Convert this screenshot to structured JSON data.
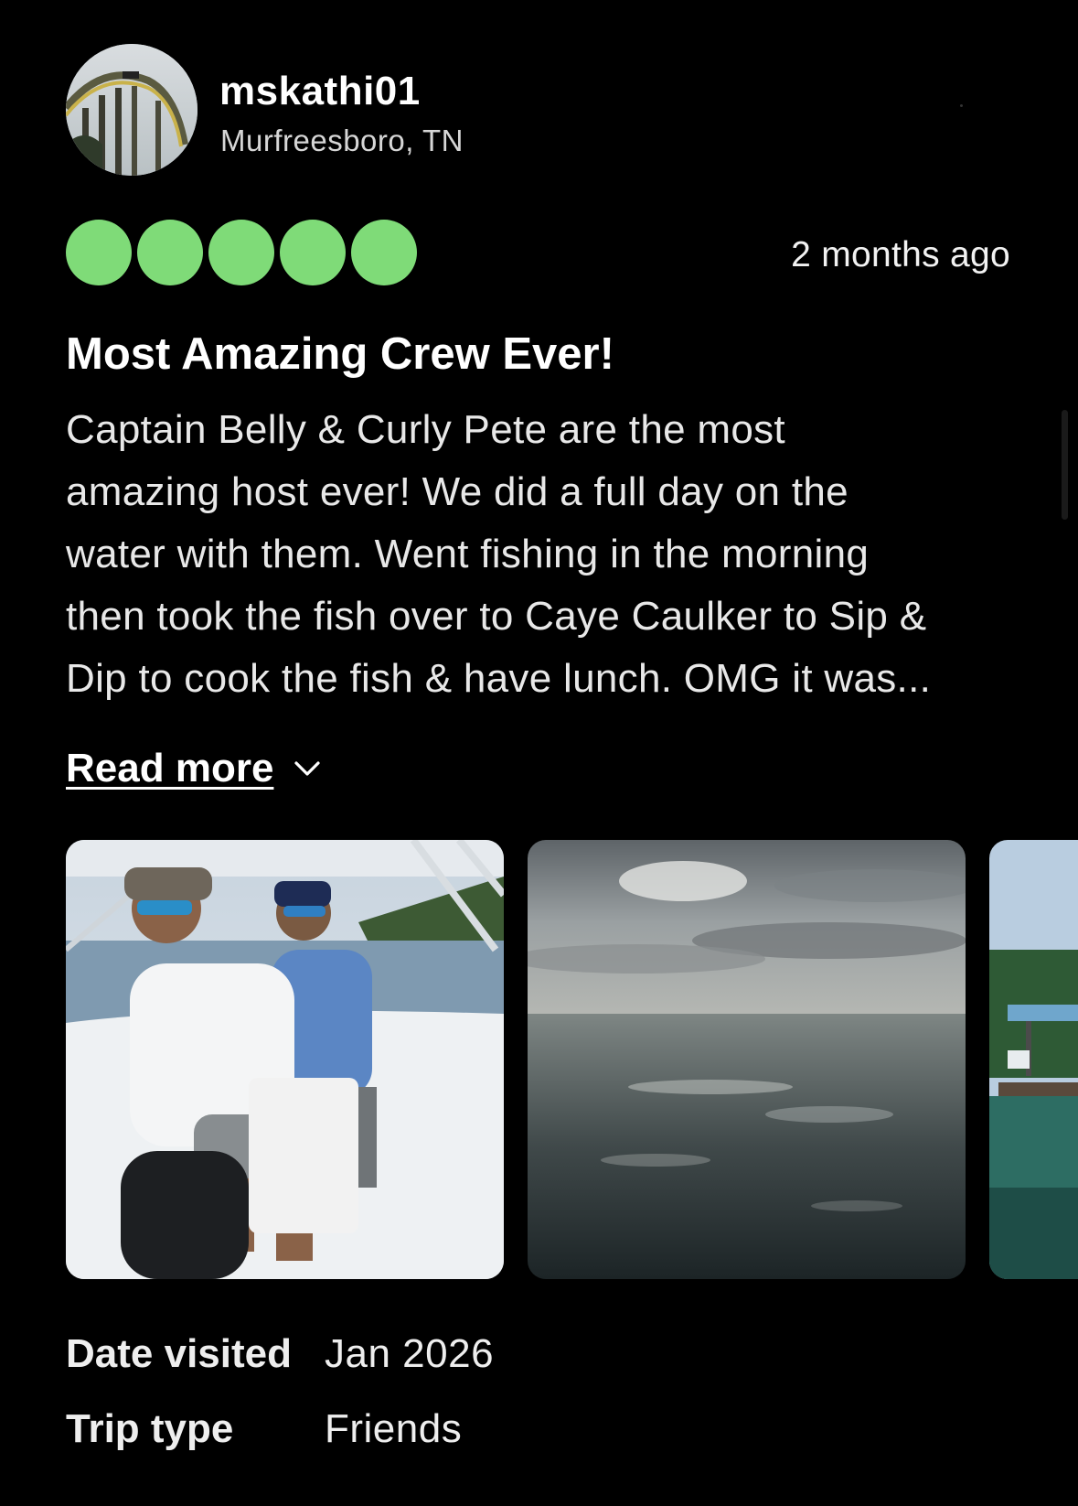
{
  "reviewer": {
    "username": "mskathi01",
    "location": "Murfreesboro, TN",
    "avatar_icon": "roller-coaster-photo"
  },
  "review": {
    "rating": 5,
    "rating_max": 5,
    "rating_color": "#7fdb78",
    "timestamp": "2 months ago",
    "title": "Most Amazing Crew Ever!",
    "body_lines": [
      "Captain Belly & Curly Pete are the most",
      "amazing host ever! We did a full day on the",
      "water with them. Went fishing in the morning",
      "then took the fish over to Caye Caulker to Sip &",
      "Dip to cook the fish & have lunch. OMG it was..."
    ],
    "read_more_label": "Read more",
    "read_more_icon": "chevron-down-icon"
  },
  "photos": [
    {
      "subject": "two-crew-members-on-boat-photo"
    },
    {
      "subject": "cloudy-sky-over-sea-photo"
    },
    {
      "subject": "dock-with-mangroves-photo"
    }
  ],
  "details": [
    {
      "label": "Date visited",
      "value": "Jan 2026"
    },
    {
      "label": "Trip type",
      "value": "Friends"
    }
  ]
}
